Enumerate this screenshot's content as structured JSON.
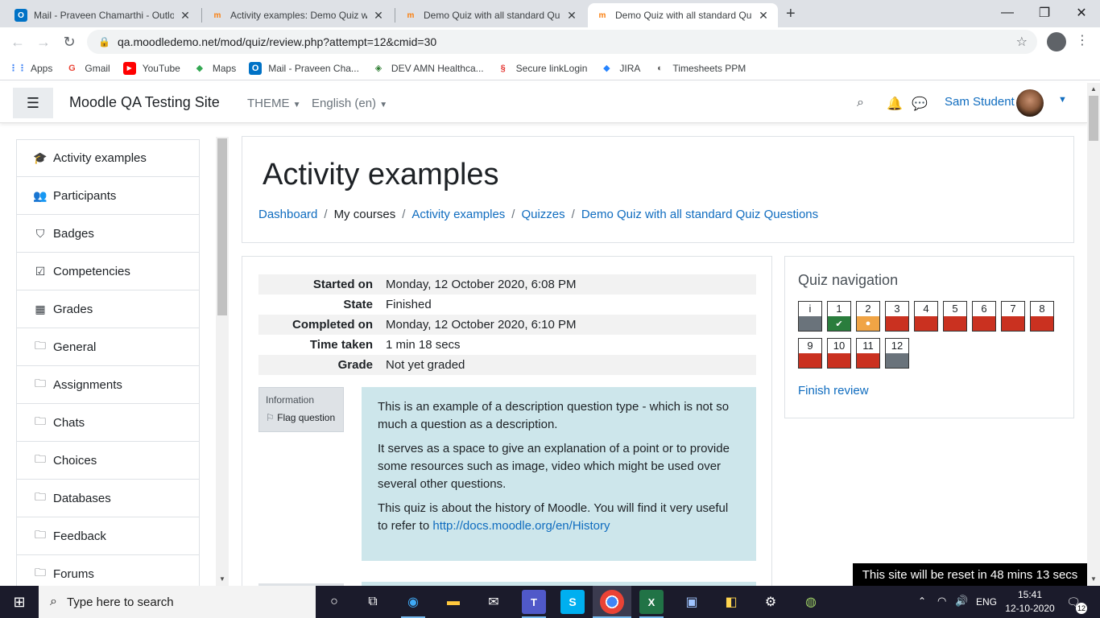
{
  "browser": {
    "tabs": [
      {
        "title": "Mail - Praveen Chamarthi - Outlo",
        "icon": "outlook-icon",
        "active": false
      },
      {
        "title": "Activity examples: Demo Quiz wi",
        "icon": "moodle-icon",
        "active": false
      },
      {
        "title": "Demo Quiz with all standard Qui",
        "icon": "moodle-icon",
        "active": false
      },
      {
        "title": "Demo Quiz with all standard Qui",
        "icon": "moodle-icon",
        "active": true
      }
    ],
    "url": "qa.moodledemo.net/mod/quiz/review.php?attempt=12&cmid=30",
    "bookmarks": [
      {
        "label": "Apps",
        "icon": "apps-grid-icon"
      },
      {
        "label": "Gmail",
        "icon": "google-icon"
      },
      {
        "label": "YouTube",
        "icon": "youtube-icon"
      },
      {
        "label": "Maps",
        "icon": "maps-icon"
      },
      {
        "label": "Mail - Praveen Cha...",
        "icon": "outlook-icon"
      },
      {
        "label": "DEV AMN Healthca...",
        "icon": "dev-amn-icon"
      },
      {
        "label": "Secure linkLogin",
        "icon": "secure-link-icon"
      },
      {
        "label": "JIRA",
        "icon": "jira-icon"
      },
      {
        "label": "Timesheets PPM",
        "icon": "timesheets-icon"
      }
    ]
  },
  "navbar": {
    "site_name": "Moodle QA Testing Site",
    "theme_label": "THEME",
    "language_label": "English (en)",
    "user_name": "Sam Student"
  },
  "drawer": {
    "items": [
      {
        "label": "Activity examples",
        "icon": "graduation-cap-icon"
      },
      {
        "label": "Participants",
        "icon": "users-icon"
      },
      {
        "label": "Badges",
        "icon": "shield-icon"
      },
      {
        "label": "Competencies",
        "icon": "checkbox-icon"
      },
      {
        "label": "Grades",
        "icon": "table-icon"
      },
      {
        "label": "General",
        "icon": "folder-icon"
      },
      {
        "label": "Assignments",
        "icon": "folder-icon"
      },
      {
        "label": "Chats",
        "icon": "folder-icon"
      },
      {
        "label": "Choices",
        "icon": "folder-icon"
      },
      {
        "label": "Databases",
        "icon": "folder-icon"
      },
      {
        "label": "Feedback",
        "icon": "folder-icon"
      },
      {
        "label": "Forums",
        "icon": "folder-icon"
      }
    ]
  },
  "header": {
    "title": "Activity examples",
    "breadcrumb": [
      {
        "label": "Dashboard",
        "link": true
      },
      {
        "label": "My courses",
        "link": false
      },
      {
        "label": "Activity examples",
        "link": true
      },
      {
        "label": "Quizzes",
        "link": true
      },
      {
        "label": "Demo Quiz with all standard Quiz Questions",
        "link": true
      }
    ]
  },
  "summary": [
    {
      "label": "Started on",
      "value": "Monday, 12 October 2020, 6:08 PM"
    },
    {
      "label": "State",
      "value": "Finished"
    },
    {
      "label": "Completed on",
      "value": "Monday, 12 October 2020, 6:10 PM"
    },
    {
      "label": "Time taken",
      "value": "1 min 18 secs"
    },
    {
      "label": "Grade",
      "value": "Not yet graded"
    }
  ],
  "question": {
    "info_label": "Information",
    "flag_label": "Flag question",
    "paragraph_1": "This is an example of a description question type - which is not so much a question as a description.",
    "paragraph_2": "It serves as a space to give an explanation of a point or to provide some resources such as image, video which might be used over several other questions.",
    "paragraph_3_text": "This quiz is about the history of Moodle. You will find it very useful to refer to",
    "paragraph_3_link": "http://docs.moodle.org/en/History"
  },
  "quiz_nav": {
    "title": "Quiz navigation",
    "buttons": [
      {
        "label": "i",
        "status": "info"
      },
      {
        "label": "1",
        "status": "correct"
      },
      {
        "label": "2",
        "status": "partial"
      },
      {
        "label": "3",
        "status": "incorrect"
      },
      {
        "label": "4",
        "status": "incorrect"
      },
      {
        "label": "5",
        "status": "incorrect"
      },
      {
        "label": "6",
        "status": "incorrect"
      },
      {
        "label": "7",
        "status": "incorrect"
      },
      {
        "label": "8",
        "status": "incorrect"
      },
      {
        "label": "9",
        "status": "incorrect"
      },
      {
        "label": "10",
        "status": "incorrect"
      },
      {
        "label": "11",
        "status": "incorrect"
      },
      {
        "label": "12",
        "status": "info"
      }
    ],
    "finish_label": "Finish review"
  },
  "reset_notice": "This site will be reset in 48 mins 13 secs",
  "taskbar": {
    "search_placeholder": "Type here to search",
    "language": "ENG",
    "time": "15:41",
    "date": "12-10-2020",
    "notification_count": "12"
  },
  "colors": {
    "link": "#0f6cbf",
    "correct": "#2a7d3d",
    "partial": "#f0a445",
    "incorrect": "#ca3120",
    "info": "#6a737b",
    "question_bg": "#cde6eb"
  }
}
